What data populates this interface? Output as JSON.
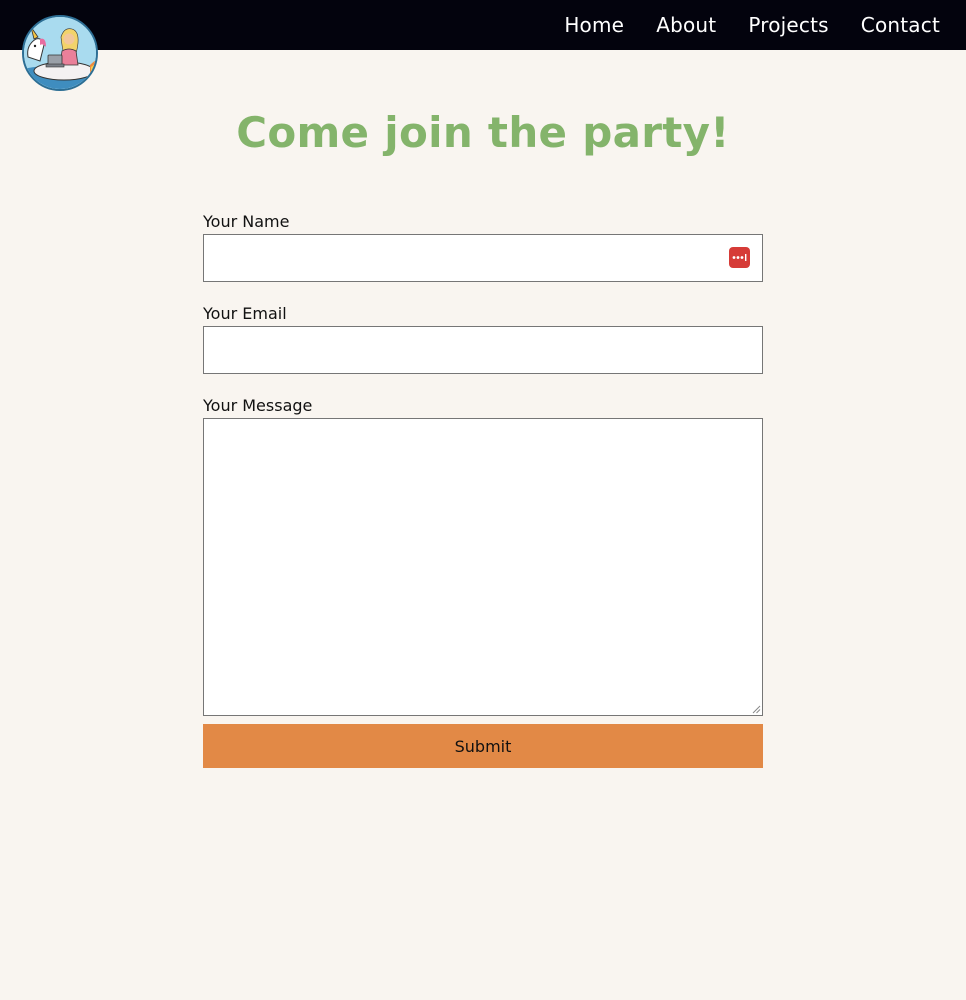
{
  "nav": {
    "items": [
      {
        "label": "Home"
      },
      {
        "label": "About"
      },
      {
        "label": "Projects"
      },
      {
        "label": "Contact"
      }
    ],
    "logo_icon": "unicorn-float-avatar-icon"
  },
  "main": {
    "heading": "Come join the party!"
  },
  "form": {
    "name_label": "Your Name",
    "name_value": "",
    "name_placeholder": "",
    "password_manager_icon": "password-manager-icon",
    "email_label": "Your Email",
    "email_value": "",
    "email_placeholder": "",
    "message_label": "Your Message",
    "message_value": "",
    "submit_label": "Submit"
  },
  "colors": {
    "nav_bg": "#03030d",
    "page_bg": "#f9f5f0",
    "heading": "#84b46b",
    "submit_bg": "#e28946",
    "password_icon_bg": "#d63b37"
  }
}
